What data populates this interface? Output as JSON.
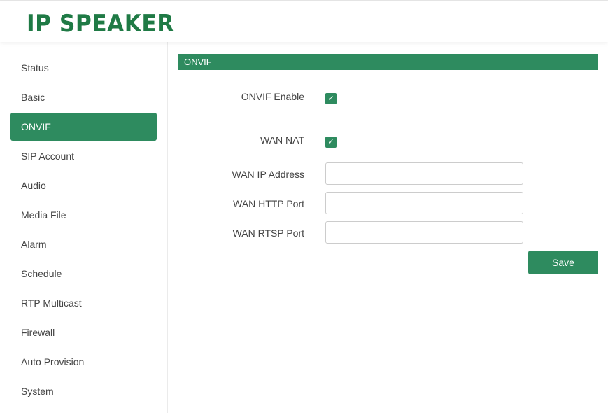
{
  "app": {
    "title": "IP SPEAKER"
  },
  "sidebar": {
    "items": [
      {
        "label": "Status",
        "active": false
      },
      {
        "label": "Basic",
        "active": false
      },
      {
        "label": "ONVIF",
        "active": true
      },
      {
        "label": "SIP Account",
        "active": false
      },
      {
        "label": "Audio",
        "active": false
      },
      {
        "label": "Media File",
        "active": false
      },
      {
        "label": "Alarm",
        "active": false
      },
      {
        "label": "Schedule",
        "active": false
      },
      {
        "label": "RTP Multicast",
        "active": false
      },
      {
        "label": "Firewall",
        "active": false
      },
      {
        "label": "Auto Provision",
        "active": false
      },
      {
        "label": "System",
        "active": false
      }
    ]
  },
  "main": {
    "section_title": "ONVIF",
    "onvif_enable": {
      "label": "ONVIF Enable",
      "checked": true
    },
    "wan_nat": {
      "label": "WAN NAT",
      "checked": true
    },
    "wan_ip": {
      "label": "WAN IP Address",
      "value": ""
    },
    "wan_http_port": {
      "label": "WAN HTTP Port",
      "value": ""
    },
    "wan_rtsp_port": {
      "label": "WAN RTSP Port",
      "value": ""
    },
    "save_label": "Save",
    "check_glyph": "✓"
  },
  "colors": {
    "accent": "#2e8b5f",
    "logo": "#1f7a45",
    "text": "#444444",
    "border": "#cccccc"
  },
  "icons": {
    "checkbox_checked": "check-icon"
  }
}
